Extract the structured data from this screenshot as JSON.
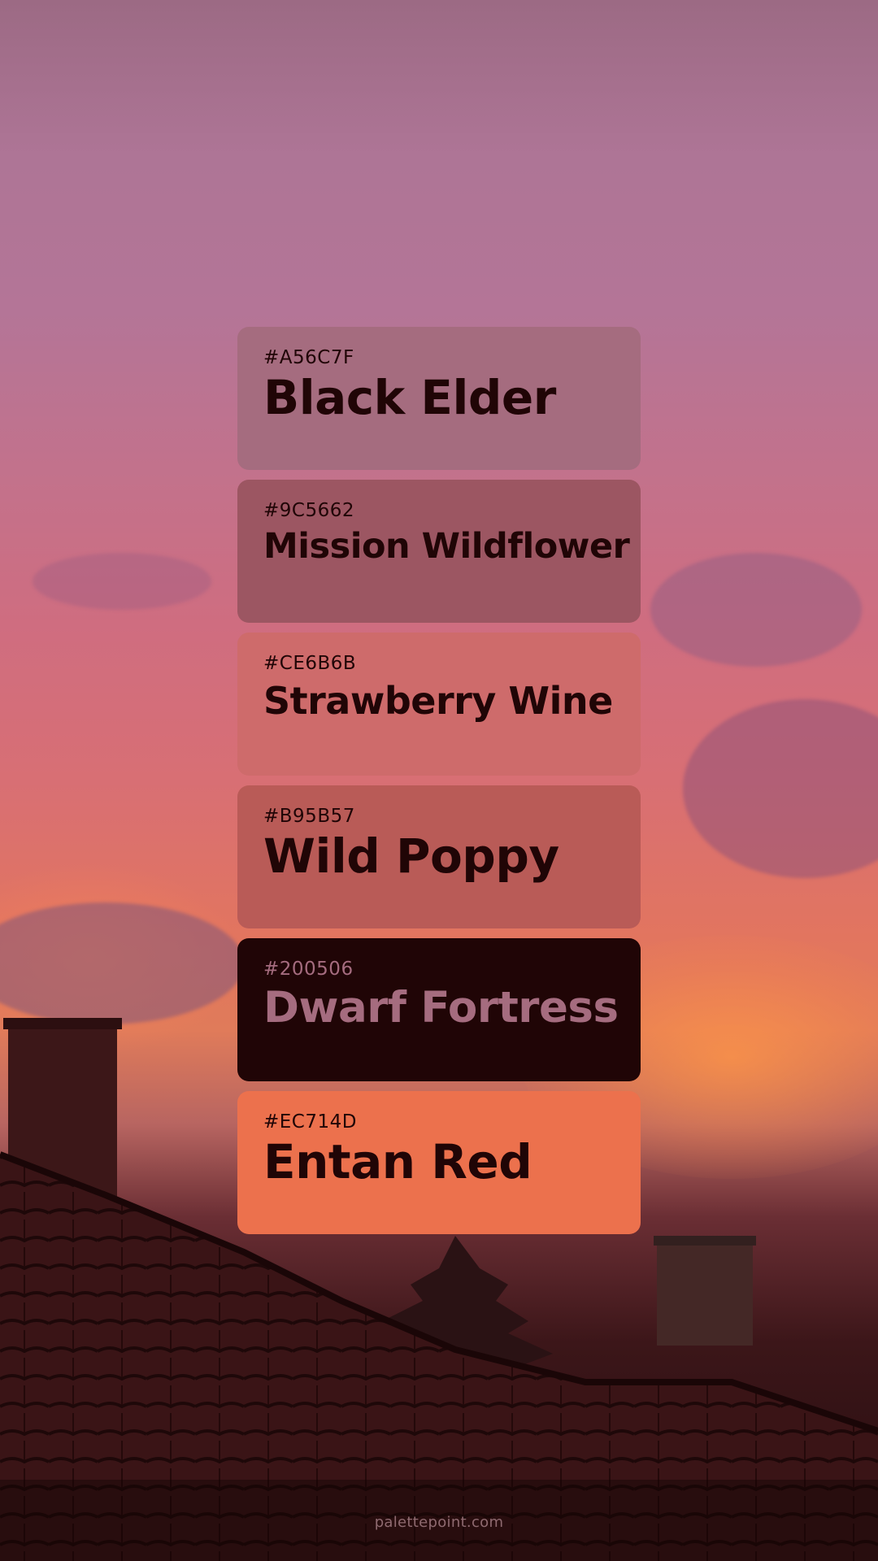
{
  "palette": {
    "swatches": [
      {
        "hex": "#A56C7F",
        "name": "Black Elder",
        "bg": "#A56C7F",
        "text_color": "#200506"
      },
      {
        "hex": "#9C5662",
        "name": "Mission Wildflower",
        "bg": "#9C5662",
        "text_color": "#200506"
      },
      {
        "hex": "#CE6B6B",
        "name": "Strawberry Wine",
        "bg": "#CE6B6B",
        "text_color": "#200506"
      },
      {
        "hex": "#B95B57",
        "name": "Wild Poppy",
        "bg": "#B95B57",
        "text_color": "#200506"
      },
      {
        "hex": "#200506",
        "name": "Dwarf Fortress",
        "bg": "#200506",
        "text_color": "#A56C7F"
      },
      {
        "hex": "#EC714D",
        "name": "Entan Red",
        "bg": "#EC714D",
        "text_color": "#200506"
      }
    ]
  },
  "footer": {
    "site": "palettepoint.com"
  }
}
